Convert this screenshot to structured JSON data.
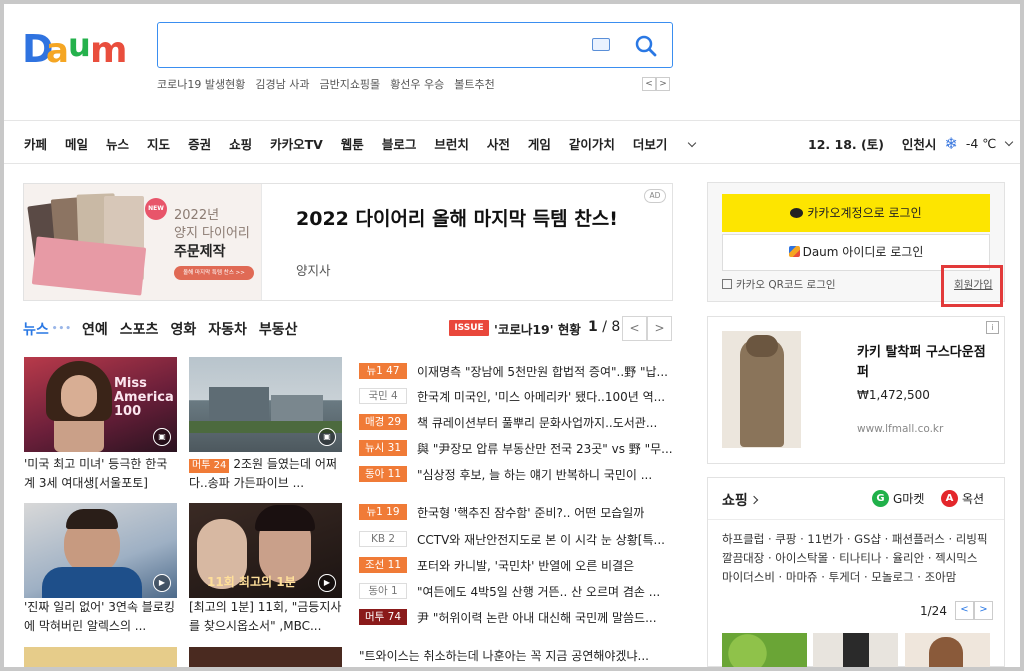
{
  "header": {
    "logo_text": "Daum",
    "search": {
      "value": "",
      "placeholder": ""
    },
    "trends": [
      "코로나19 발생현황",
      "김경남 사과",
      "금반지쇼핑몰",
      "황선우 우승",
      "볼트추천"
    ],
    "trend_prev": "<",
    "trend_next": ">"
  },
  "nav": {
    "items": [
      "카페",
      "메일",
      "뉴스",
      "지도",
      "증권",
      "쇼핑",
      "카카오TV",
      "웹툰",
      "블로그",
      "브런치",
      "사전",
      "게임",
      "같이가치"
    ],
    "more": "더보기"
  },
  "weather": {
    "date": "12. 18. (토)",
    "city": "인천시",
    "temp": "-4 ℃",
    "icon": "snow-icon"
  },
  "ad": {
    "img_new": "NEW",
    "img_line1": "2022년",
    "img_line2": "양지 다이어리",
    "img_line3": "주문제작",
    "img_button": "올해 마지막 특템 찬스 >>",
    "title": "2022 다이어리 올해 마지막 득템 찬스!",
    "subtitle": "양지사",
    "badge": "AD"
  },
  "news_tabs": {
    "active": "뉴스",
    "dots": "•••",
    "tabs": [
      "연예",
      "스포츠",
      "영화",
      "자동차",
      "부동산"
    ]
  },
  "issue": {
    "badge": "ISSUE",
    "text": "'코로나19' 현황"
  },
  "pager": {
    "current": "1",
    "total": " / 8",
    "prev": "<",
    "next": ">"
  },
  "thumbs": [
    {
      "caption": "'미국 최고 미녀' 등극한 한국계 3세 여대생[서울포토]",
      "tag": ""
    },
    {
      "caption": "2조원 들였는데 어쩌다..송파 가든파이브 ...",
      "tag": "머투 24"
    },
    {
      "caption": "'진짜 일리 없어' 3연속 블로킹에 막혀버린 알렉스의 ...",
      "tag": ""
    },
    {
      "caption": "[최고의 1분] 11회, \"금등지사를 찾으시옵소서\" ,MBC...",
      "tag": ""
    }
  ],
  "news_list": [
    {
      "src": "뉴1 47",
      "style": "hot",
      "text": "이재명측 \"장남에 5천만원 합법적 증여\"..野 \"납..."
    },
    {
      "src": "국민 4",
      "style": "cold",
      "text": "한국계 미국인, '미스 아메리카' 됐다..100년 역..."
    },
    {
      "src": "매경 29",
      "style": "hot",
      "text": "책 큐레이션부터 풀뿌리 문화사업까지..도서관..."
    },
    {
      "src": "뉴시 31",
      "style": "hot",
      "text": "與 \"尹장모 압류 부동산만 전국 23곳\" vs 野 \"무..."
    },
    {
      "src": "동아 11",
      "style": "hot",
      "text": "\"심상정 후보, 늘 하는 얘기 반복하니 국민이 ..."
    },
    {
      "src": "뉴1 19",
      "style": "hot",
      "text": "한국형 '핵추진 잠수함' 준비?.. 어떤 모습일까"
    },
    {
      "src": "KB 2",
      "style": "cold",
      "text": "CCTV와 재난안전지도로 본 이 시각 눈 상황[특..."
    },
    {
      "src": "조선 11",
      "style": "hot",
      "text": "포터와 카니발, '국민차' 반열에 오른 비결은"
    },
    {
      "src": "동아 1",
      "style": "cold",
      "text": "\"여든에도 4박5일 산행 거뜬.. 산 오르며 겸손 ..."
    },
    {
      "src": "머투 74",
      "style": "dark",
      "text": "尹 \"허위이력 논란 아내 대신해 국민께 말씀드..."
    },
    {
      "src": "",
      "style": "none",
      "text": "\"트와이스는 취소하는데 나훈아는 꼭 지금 공연해야겠냐..."
    }
  ],
  "login": {
    "kakao": "카카오계정으로 로그인",
    "daum_logo": "Daum",
    "daum": "아이디로 로그인",
    "qr": "카카오 QR코드 로그인",
    "signup": "회원가입"
  },
  "product": {
    "name": "카키 탈착퍼 구스다운점퍼",
    "price": "₩1,472,500",
    "url": "www.lfmall.co.kr",
    "info": "i"
  },
  "shopping": {
    "title": "쇼핑",
    "gmarket": "G마켓",
    "auction": "옥션",
    "links_line1": "하프클럽 · 쿠팡 · 11번가 · GS샵 · 패션플러스 · 리빙픽",
    "links_line2": "깔끔대장 · 아이스탁몰 · 티나티나 · 율리안 · 젝시믹스",
    "links_line3": "마이더스비 · 마마쥬 · 투게더 · 모놀로그 · 조아맘",
    "page": "1/24",
    "prev": "<",
    "next": ">"
  },
  "colors": {
    "accent_blue": "#2a78e4",
    "kakao_yellow": "#fde500",
    "news_orange": "#f07b37",
    "issue_red": "#e9473b",
    "highlight_red": "#e23a3a"
  }
}
